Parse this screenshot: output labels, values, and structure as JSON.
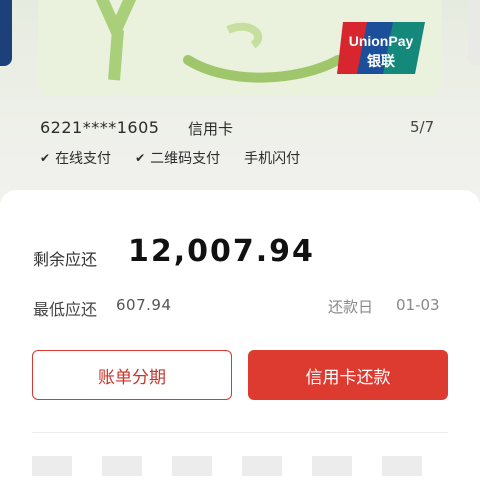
{
  "card": {
    "number": "6221****1605",
    "type": "信用卡",
    "page": "5/7",
    "brand_en": "UnionPay",
    "brand_cn": "银联"
  },
  "features": [
    {
      "label": "在线支付",
      "icon": "check-icon"
    },
    {
      "label": "二维码支付",
      "icon": "check-icon"
    },
    {
      "label": "手机闪付",
      "icon": ""
    }
  ],
  "bill": {
    "remain_label": "剩余应还",
    "remain_amount": "12,007.94",
    "min_label": "最低应还",
    "min_amount": "607.94",
    "due_label": "还款日",
    "due_date": "01-03"
  },
  "buttons": {
    "installment": "账单分期",
    "repay": "信用卡还款"
  },
  "colors": {
    "accent": "#dd3a30",
    "card_bg": "#eaf2dd"
  }
}
